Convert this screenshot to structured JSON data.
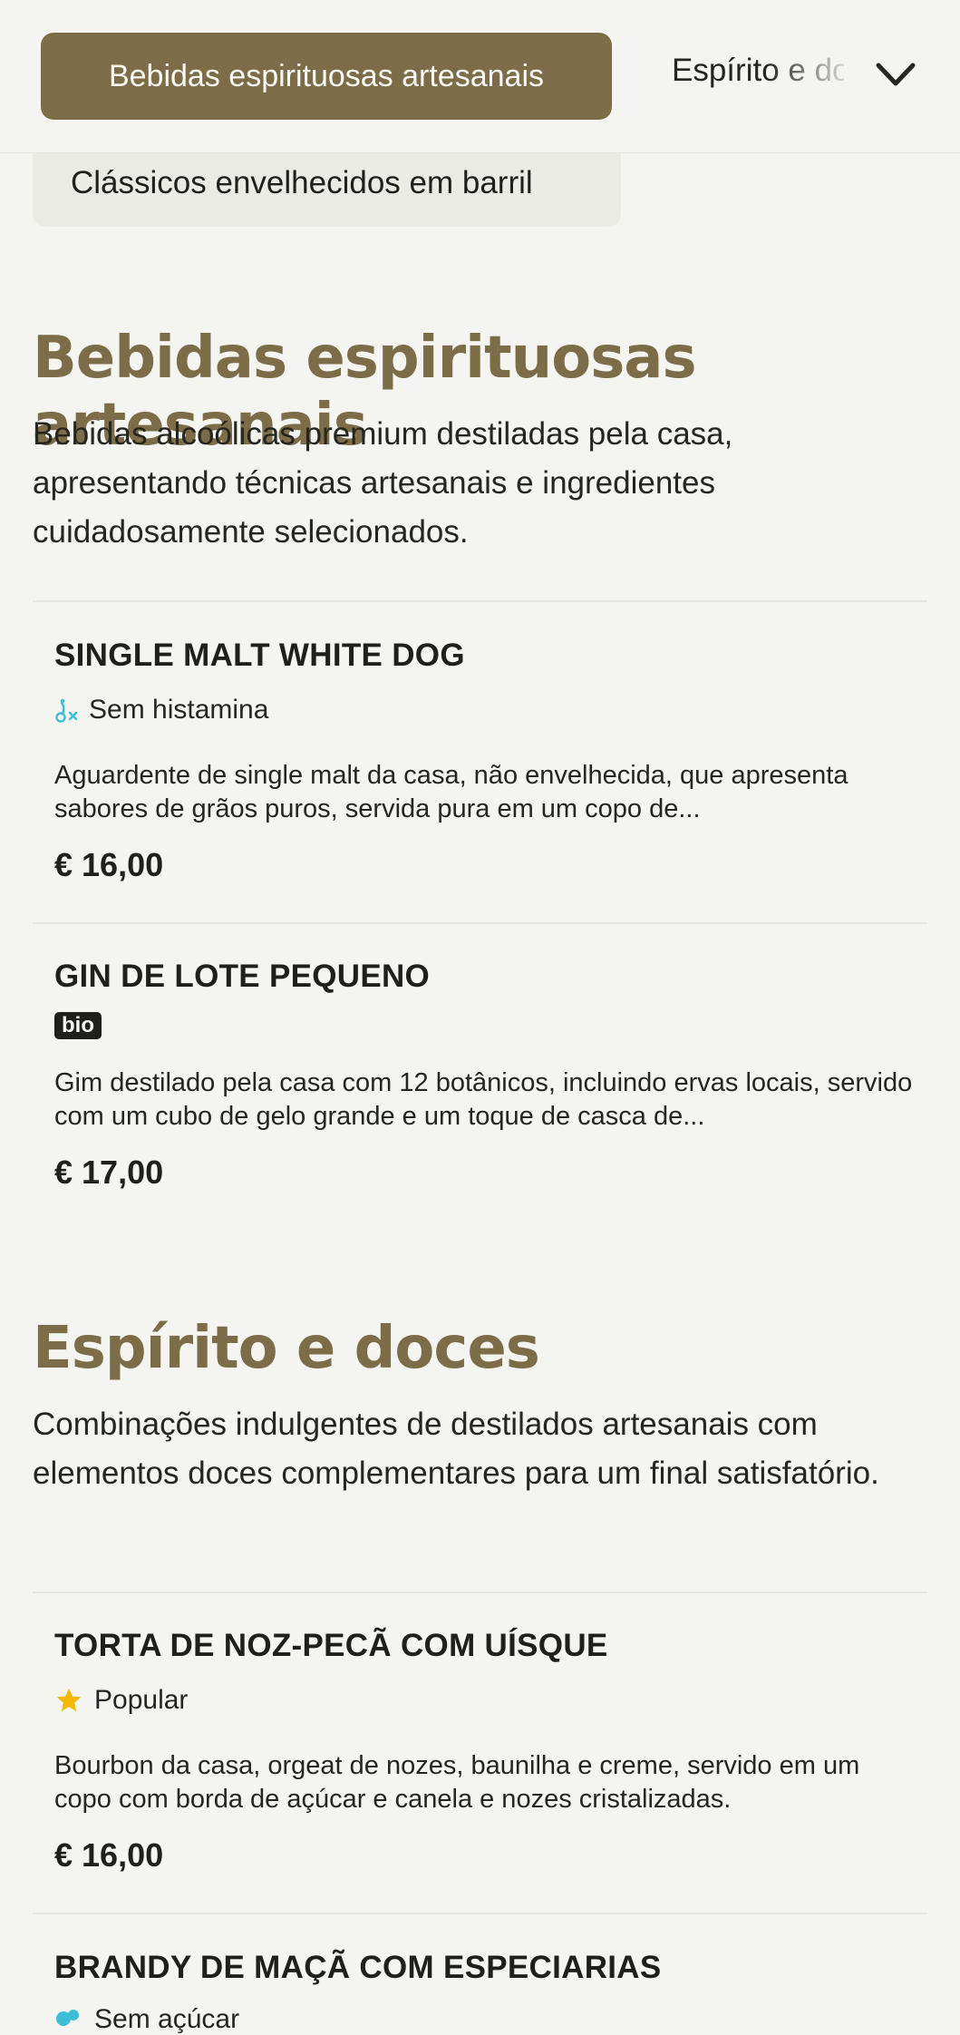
{
  "nav": {
    "active_tab": "Bebidas espirituosas artesanais",
    "next_tab": "Espírito e doces",
    "sub_chip": "Clássicos envelhecidos em barril"
  },
  "sections": [
    {
      "title": "Bebidas espirituosas artesanais",
      "description": "Bebidas alcoólicas premium destiladas pela casa, apresentando técnicas artesanais e ingredientes cuidadosamente selecionados.",
      "items": [
        {
          "name": "SINGLE MALT WHITE DOG",
          "tag": "Sem histamina",
          "tag_icon": "histamine-free-icon",
          "description": "Aguardente de single malt da casa, não envelhecida, que apresenta sabores de grãos puros, servida pura em um copo de...",
          "price": "€ 16,00"
        },
        {
          "name": "GIN DE LOTE PEQUENO",
          "tag": "bio",
          "tag_icon": "bio-badge",
          "description": "Gim destilado pela casa com 12 botânicos, incluindo ervas locais, servido com um cubo de gelo grande e um toque de casca de...",
          "price": "€ 17,00"
        }
      ]
    },
    {
      "title": "Espírito e doces",
      "description": "Combinações indulgentes de destilados artesanais com elementos doces complementares para um final satisfatório.",
      "items": [
        {
          "name": "TORTA DE NOZ-PECÃ COM UÍSQUE",
          "tag": "Popular",
          "tag_icon": "star-icon",
          "description": "Bourbon da casa, orgeat de nozes, baunilha e creme, servido em um copo com borda de açúcar e canela e nozes cristalizadas.",
          "price": "€ 16,00"
        },
        {
          "name": "BRANDY DE MAÇÃ COM ESPECIARIAS",
          "tag": "Sem açúcar",
          "tag_icon": "sugar-free-icon"
        }
      ]
    }
  ],
  "colors": {
    "accent": "#7c6c48",
    "background": "#f4f4f0",
    "star": "#f5b800",
    "histamine_icon": "#3bbfd6"
  }
}
